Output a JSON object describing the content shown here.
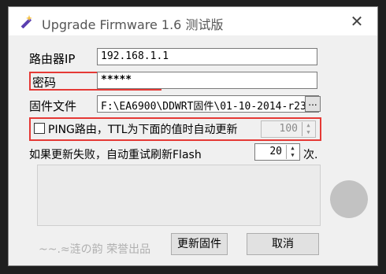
{
  "window": {
    "title": "Upgrade Firmware 1.6 测试版",
    "close_glyph": "✕"
  },
  "form": {
    "router_ip_label": "路由器IP",
    "router_ip_value": "192.168.1.1",
    "password_label": "密码",
    "password_value": "*****",
    "firmware_label": "固件文件",
    "firmware_path": "F:\\EA6900\\DDWRT固件\\01-10-2014-r23",
    "browse_label": "...",
    "ping_checkbox_label": "PING路由，TTL为下面的值时自动更新",
    "ping_checked": false,
    "ttl_value": "100",
    "retry_label": "如果更新失败，自动重试刷新Flash",
    "retry_value": "20",
    "retry_unit": "次."
  },
  "footer": {
    "credit_text": "~~.≈涟の韵 荣誉出品",
    "update_button": "更新固件",
    "cancel_button": "取消"
  },
  "colors": {
    "highlight": "#e53935",
    "window_bg": "#f0f0f0",
    "outer_bg": "#1f1f1f"
  },
  "icons": {
    "app": "wand-icon",
    "close": "close-icon",
    "spin_up": "arrow-up-icon",
    "spin_down": "arrow-down-icon",
    "status": "status-circle-icon"
  }
}
